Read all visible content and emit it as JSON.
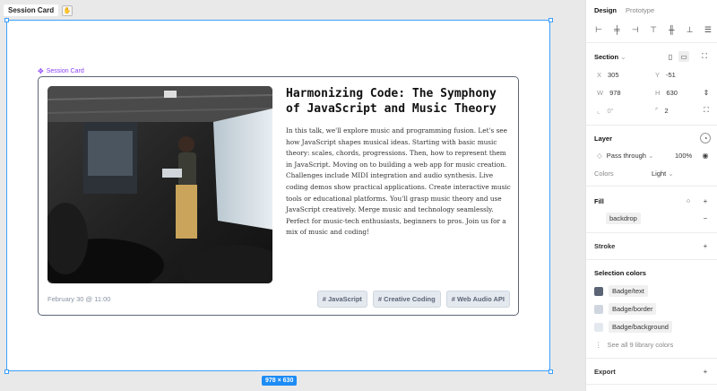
{
  "canvas": {
    "frame_name": "Session Card",
    "component_label": "Session Card",
    "size_badge": "978 × 630"
  },
  "card": {
    "title": "Harmonizing Code: The Symphony of JavaScript and Music Theory",
    "description": "In this talk, we'll explore music and programming fusion. Let's see how JavaScript shapes musical ideas. Starting with basic music theory: scales, chords, progressions. Then, how to represent them in JavaScript. Moving on to building a web app for music creation. Challenges include MIDI integration and audio synthesis. Live coding demos show practical applications. Create interactive music tools or educational platforms. You'll grasp music theory and use JavaScript creatively. Merge music and technology seamlessly. Perfect for music-tech enthusiasts, beginners to pros. Join us for a mix of music and coding!",
    "date": "February 30 @ 11:00",
    "tags": [
      "# JavaScript",
      "# Creative Coding",
      "# Web Audio API"
    ]
  },
  "panel": {
    "tabs": [
      "Design",
      "Prototype"
    ],
    "section": {
      "title": "Section",
      "x_label": "X",
      "x": "305",
      "y_label": "Y",
      "y": "-51",
      "w_label": "W",
      "w": "978",
      "h_label": "H",
      "h": "630",
      "radius": "0°",
      "stroke_count": "2"
    },
    "layer": {
      "title": "Layer",
      "blend": "Pass through",
      "opacity": "100%",
      "colors_label": "Colors",
      "colors_value": "Light"
    },
    "fill": {
      "title": "Fill",
      "value": "backdrop"
    },
    "stroke": {
      "title": "Stroke"
    },
    "selection_colors": {
      "title": "Selection colors",
      "items": [
        {
          "label": "Badge/text",
          "color": "#5b6475"
        },
        {
          "label": "Badge/border",
          "color": "#cfd6e0"
        },
        {
          "label": "Badge/background",
          "color": "#e4e9f0"
        }
      ],
      "see_all": "See all 9 library colors"
    },
    "export": {
      "title": "Export"
    }
  },
  "colors": {
    "accent": "#3ca0ff",
    "component": "#8a3ffc"
  }
}
